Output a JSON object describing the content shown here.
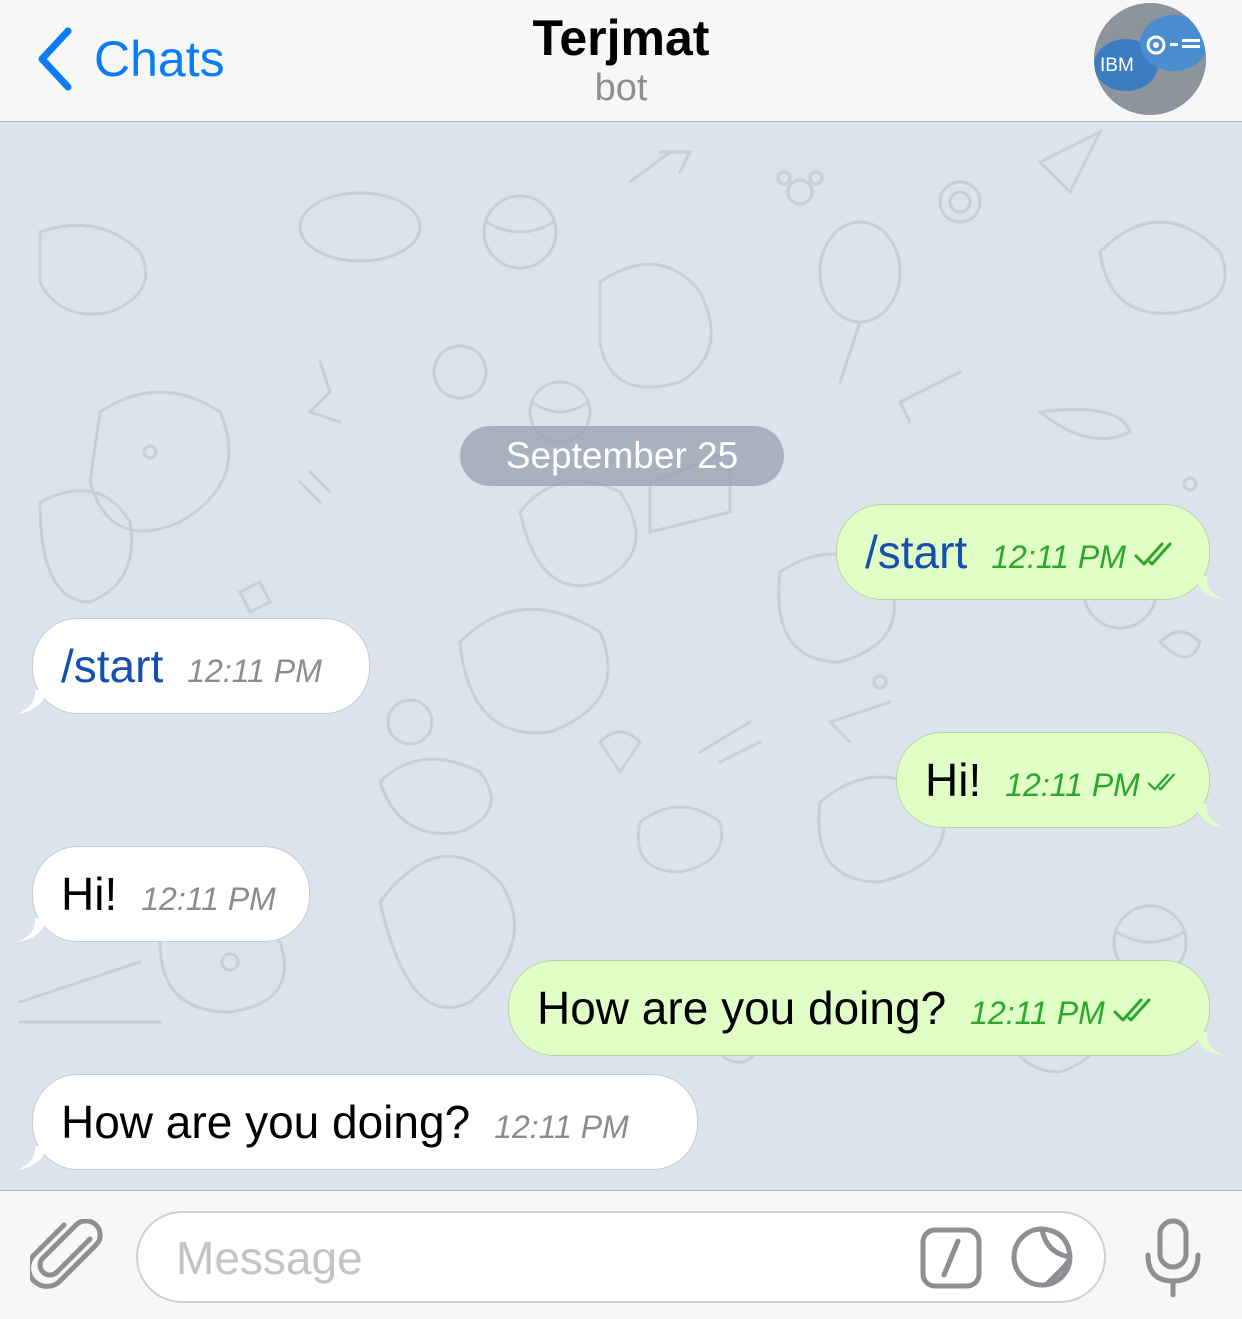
{
  "header": {
    "back_label": "Chats",
    "title": "Terjmat",
    "subtitle": "bot",
    "avatar_text": "IBM"
  },
  "chat": {
    "date_label": "September 25",
    "messages": [
      {
        "direction": "out",
        "text": "/start",
        "time": "12:11 PM",
        "is_command": true,
        "read": true
      },
      {
        "direction": "in",
        "text": "/start",
        "time": "12:11 PM",
        "is_command": true
      },
      {
        "direction": "out",
        "text": "Hi!",
        "time": "12:11 PM",
        "read": true
      },
      {
        "direction": "in",
        "text": "Hi!",
        "time": "12:11 PM"
      },
      {
        "direction": "out",
        "text": "How are you doing?",
        "time": "12:11 PM",
        "read": true
      },
      {
        "direction": "in",
        "text": "How are you doing?",
        "time": "12:11 PM"
      }
    ]
  },
  "composer": {
    "placeholder": "Message"
  },
  "colors": {
    "accent": "#0a7cf5",
    "outgoing_bubble": "#e1fec7",
    "incoming_bubble": "#ffffff",
    "chat_background": "#dde3ec",
    "read_check": "#2ba82b"
  },
  "icons": {
    "back": "chevron-left-icon",
    "attach": "paperclip-icon",
    "command": "slash-command-icon",
    "sticker": "sticker-icon",
    "voice": "microphone-icon",
    "read_status": "double-check-icon"
  }
}
